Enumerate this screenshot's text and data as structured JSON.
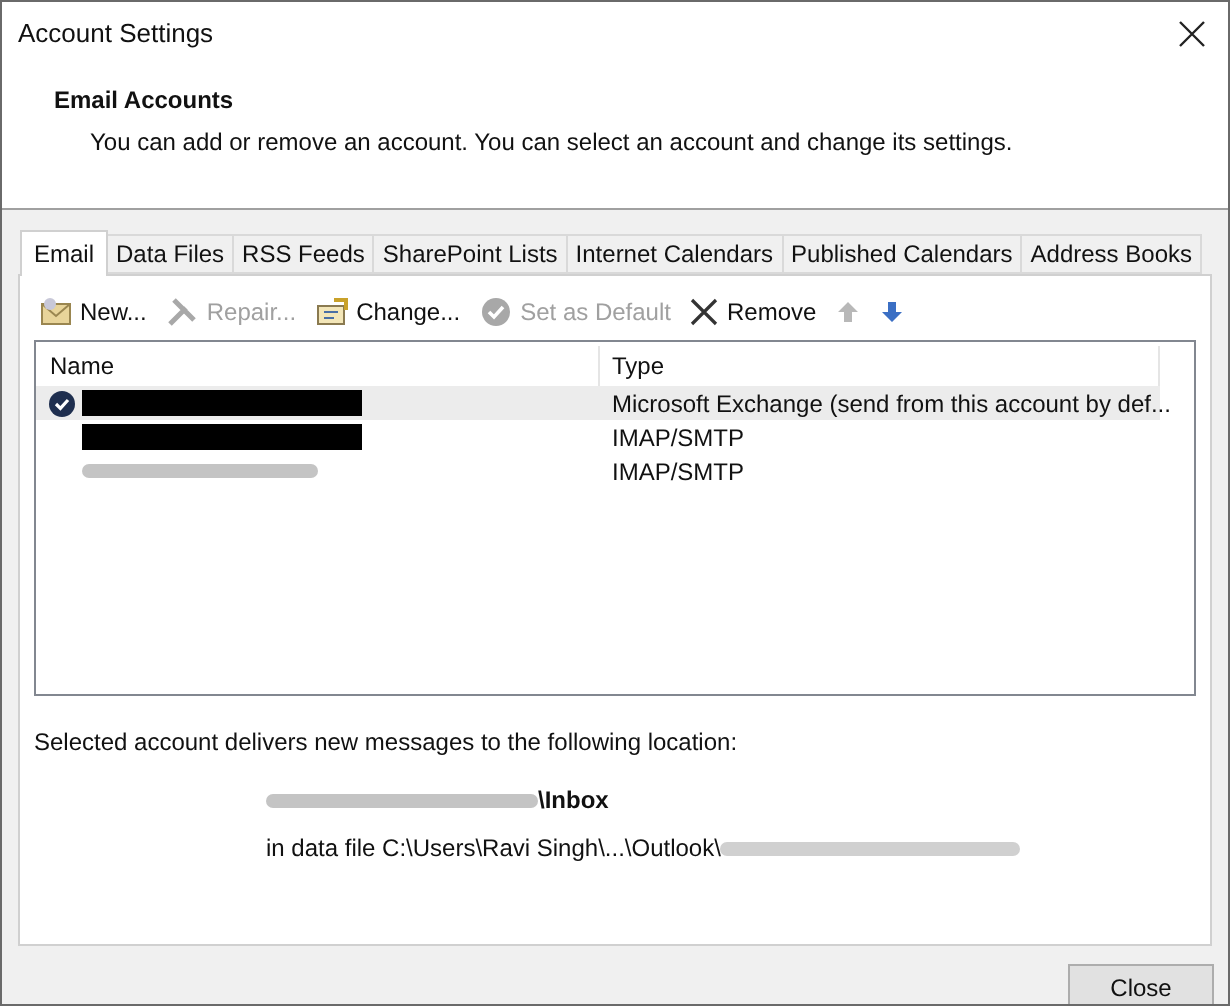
{
  "window": {
    "title": "Account Settings"
  },
  "header": {
    "title": "Email Accounts",
    "description": "You can add or remove an account. You can select an account and change its settings."
  },
  "tabs": [
    {
      "label": "Email",
      "selected": true
    },
    {
      "label": "Data Files",
      "selected": false
    },
    {
      "label": "RSS Feeds",
      "selected": false
    },
    {
      "label": "SharePoint Lists",
      "selected": false
    },
    {
      "label": "Internet Calendars",
      "selected": false
    },
    {
      "label": "Published Calendars",
      "selected": false
    },
    {
      "label": "Address Books",
      "selected": false
    }
  ],
  "toolbar": [
    {
      "kind": "new",
      "label": "New...",
      "disabled": false
    },
    {
      "kind": "repair",
      "label": "Repair...",
      "disabled": true
    },
    {
      "kind": "change",
      "label": "Change...",
      "disabled": false
    },
    {
      "kind": "default",
      "label": "Set as Default",
      "disabled": true
    },
    {
      "kind": "remove",
      "label": "Remove",
      "disabled": false
    },
    {
      "kind": "up",
      "disabled": true
    },
    {
      "kind": "down",
      "disabled": false
    }
  ],
  "table": {
    "columns": [
      "Name",
      "Type"
    ],
    "rows": [
      {
        "kind": "redacted",
        "default": true,
        "selected": true,
        "type": "Microsoft Exchange (send from this account by def..."
      },
      {
        "kind": "redacted",
        "default": false,
        "selected": false,
        "type": "IMAP/SMTP"
      },
      {
        "kind": "blurred",
        "default": false,
        "selected": false,
        "type": "IMAP/SMTP"
      }
    ]
  },
  "location": {
    "caption": "Selected account delivers new messages to the following location:",
    "folder": "\\Inbox",
    "data_file": "in data file C:\\Users\\Ravi Singh\\...\\Outlook\\"
  },
  "buttons": [
    {
      "label": "Close"
    }
  ]
}
